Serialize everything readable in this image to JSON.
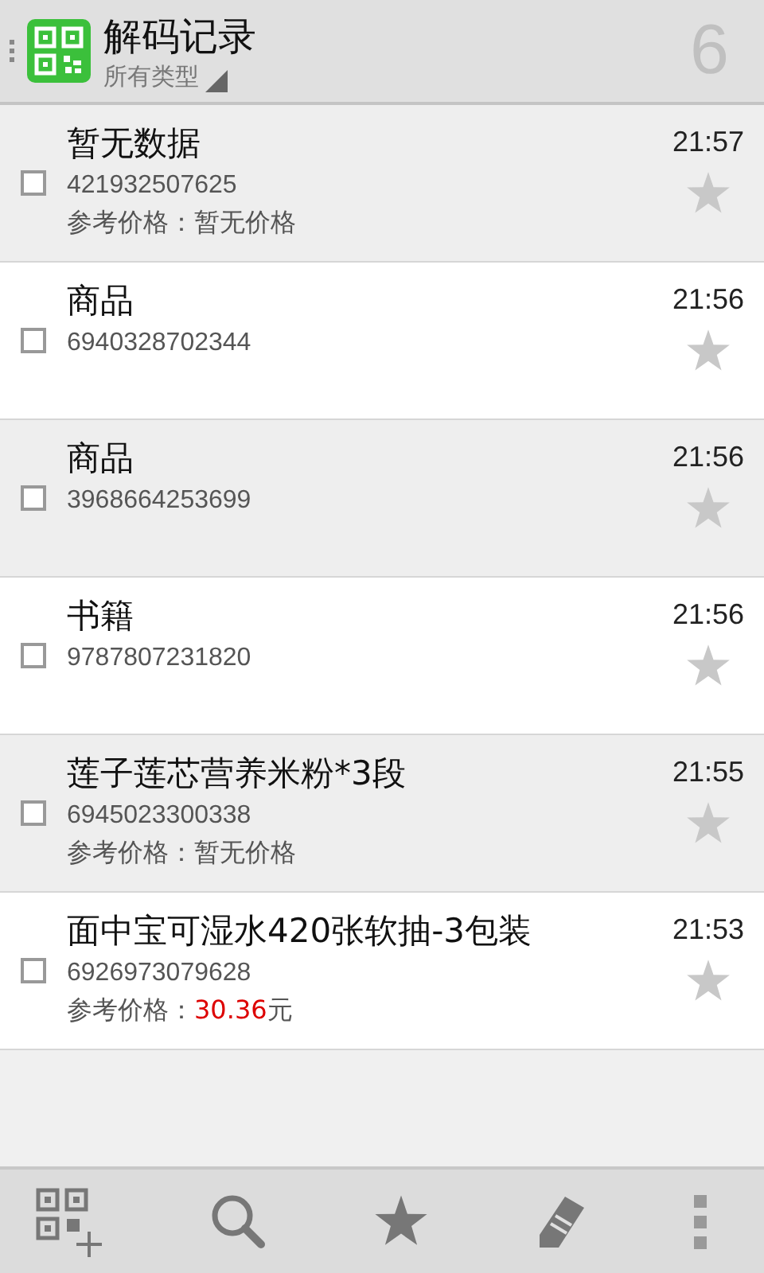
{
  "header": {
    "title": "解码记录",
    "filter": "所有类型",
    "count": "6"
  },
  "records": [
    {
      "title": "暂无数据",
      "code": "421932507625",
      "time": "21:57",
      "checked": false,
      "starred": false,
      "price": {
        "label": "参考价格：",
        "value": "暂无价格",
        "highlighted": false
      }
    },
    {
      "title": "商品",
      "code": "6940328702344",
      "time": "21:56",
      "checked": false,
      "starred": false
    },
    {
      "title": "商品",
      "code": "3968664253699",
      "time": "21:56",
      "checked": false,
      "starred": false
    },
    {
      "title": "书籍",
      "code": "9787807231820",
      "time": "21:56",
      "checked": false,
      "starred": false
    },
    {
      "title": "莲子莲芯营养米粉*3段",
      "code": "6945023300338",
      "time": "21:55",
      "checked": false,
      "starred": false,
      "price": {
        "label": "参考价格：",
        "value": "暂无价格",
        "highlighted": false
      }
    },
    {
      "title": "面中宝可湿水420张软抽-3包装",
      "code": "6926973079628",
      "time": "21:53",
      "checked": false,
      "starred": false,
      "price": {
        "label": "参考价格：",
        "value": "30.36",
        "unit": "元",
        "highlighted": true
      }
    }
  ]
}
